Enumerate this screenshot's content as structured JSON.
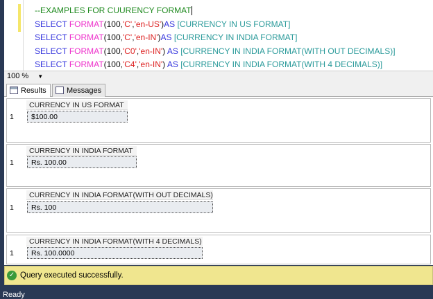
{
  "editor": {
    "lines": [
      [
        {
          "t": "--EXAMPLES FOR CUURENCY FORMAT",
          "c": "cm"
        }
      ],
      [
        {
          "t": "SELECT ",
          "c": "kw"
        },
        {
          "t": "FORMAT",
          "c": "fn"
        },
        {
          "t": "(",
          "c": "num"
        },
        {
          "t": "100",
          "c": "num"
        },
        {
          "t": ",",
          "c": "num"
        },
        {
          "t": "'C'",
          "c": "str"
        },
        {
          "t": ",",
          "c": "num"
        },
        {
          "t": "'en-US'",
          "c": "str"
        },
        {
          "t": ")",
          "c": "num"
        },
        {
          "t": "AS ",
          "c": "kw"
        },
        {
          "t": "[CURRENCY IN US FORMAT]",
          "c": "id"
        }
      ],
      [
        {
          "t": "SELECT ",
          "c": "kw"
        },
        {
          "t": "FORMAT",
          "c": "fn"
        },
        {
          "t": "(",
          "c": "num"
        },
        {
          "t": "100",
          "c": "num"
        },
        {
          "t": ",",
          "c": "num"
        },
        {
          "t": "'C'",
          "c": "str"
        },
        {
          "t": ",",
          "c": "num"
        },
        {
          "t": "'en-IN'",
          "c": "str"
        },
        {
          "t": ")",
          "c": "num"
        },
        {
          "t": "AS ",
          "c": "kw"
        },
        {
          "t": "[CURRENCY IN INDIA FORMAT]",
          "c": "id"
        }
      ],
      [
        {
          "t": "SELECT ",
          "c": "kw"
        },
        {
          "t": "FORMAT",
          "c": "fn"
        },
        {
          "t": "(",
          "c": "num"
        },
        {
          "t": "100",
          "c": "num"
        },
        {
          "t": ",",
          "c": "num"
        },
        {
          "t": "'C0'",
          "c": "str"
        },
        {
          "t": ",",
          "c": "num"
        },
        {
          "t": "'en-IN'",
          "c": "str"
        },
        {
          "t": ") ",
          "c": "num"
        },
        {
          "t": "AS ",
          "c": "kw"
        },
        {
          "t": "[CURRENCY IN INDIA FORMAT(WITH OUT DECIMALS)]",
          "c": "id"
        }
      ],
      [
        {
          "t": "SELECT ",
          "c": "kw"
        },
        {
          "t": "FORMAT",
          "c": "fn"
        },
        {
          "t": "(",
          "c": "num"
        },
        {
          "t": "100",
          "c": "num"
        },
        {
          "t": ",",
          "c": "num"
        },
        {
          "t": "'C4'",
          "c": "str"
        },
        {
          "t": ",",
          "c": "num"
        },
        {
          "t": "'en-IN'",
          "c": "str"
        },
        {
          "t": ") ",
          "c": "num"
        },
        {
          "t": "AS ",
          "c": "kw"
        },
        {
          "t": "[CURRENCY IN INDIA FORMAT(WITH 4 DECIMALS)]",
          "c": "id"
        }
      ]
    ]
  },
  "zoom": "100 %",
  "tabs": {
    "results": "Results",
    "messages": "Messages"
  },
  "grids": [
    {
      "header": "CURRENCY IN US FORMAT",
      "row": "1",
      "value": "$100.00"
    },
    {
      "header": "CURRENCY IN INDIA FORMAT",
      "row": "1",
      "value": "Rs. 100.00"
    },
    {
      "header": "CURRENCY IN INDIA FORMAT(WITH OUT DECIMALS)",
      "row": "1",
      "value": "Rs. 100"
    },
    {
      "header": "CURRENCY IN INDIA FORMAT(WITH 4 DECIMALS)",
      "row": "1",
      "value": "Rs. 100.0000"
    }
  ],
  "status": "Query executed successfully.",
  "ready": "Ready"
}
